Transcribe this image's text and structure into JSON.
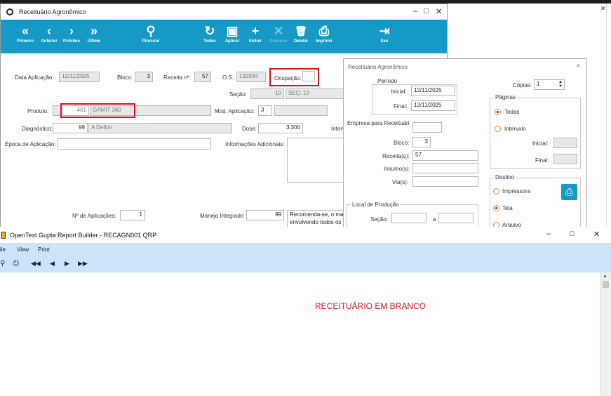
{
  "main_window": {
    "title": "Receituário Agronômico",
    "toolbar": [
      {
        "icon": "«",
        "label": "Primeiro",
        "name": "first"
      },
      {
        "icon": "‹",
        "label": "Anterior",
        "name": "previous"
      },
      {
        "icon": "›",
        "label": "Próximo",
        "name": "next"
      },
      {
        "icon": "»",
        "label": "Último",
        "name": "last"
      },
      {
        "icon": "⚲",
        "label": "Procurar",
        "name": "search"
      },
      {
        "icon": "↻",
        "label": "Todos",
        "name": "all"
      },
      {
        "icon": "▣",
        "label": "Aplicar",
        "name": "apply"
      },
      {
        "icon": "+",
        "label": "Incluir",
        "name": "include"
      },
      {
        "icon": "✕",
        "label": "Cancelar",
        "name": "cancel"
      },
      {
        "icon": "🗑",
        "label": "Deletar",
        "name": "delete"
      },
      {
        "icon": "⎙",
        "label": "Imprimir",
        "name": "print"
      },
      {
        "icon": "⇥",
        "label": "Sair",
        "name": "exit"
      }
    ],
    "form": {
      "data_aplicacao_label": "Data Aplicação:",
      "data_aplicacao": "12/11/2025",
      "bloco_label": "Bloco:",
      "bloco": "3",
      "receita_label": "Receita nº:",
      "receita": "57",
      "os_label": "O.S.:",
      "os": "132934",
      "ocupacao_label": "Ocupação:",
      "ocupacao": "",
      "secao_label": "Seção:",
      "secao": "10",
      "sec_label": "SEÇ:",
      "sec": "10",
      "produto_label": "Produto:",
      "produto_code": "461",
      "produto_name": "GAMIT 360",
      "mod_aplicacao_label": "Mod. Aplicação:",
      "mod_aplicacao": "3",
      "diagnostico_label": "Diagnóstico:",
      "diagnostico_code": "99",
      "diagnostico_name": "A Definir",
      "dose_label": "Dose:",
      "dose": "3,300",
      "interv_label": "Interv",
      "epoca_label": "Época de Aplicação:",
      "epoca": "",
      "info_label": "Informações Adicionais:",
      "n_aplicacoes_label": "Nº de Aplicações:",
      "n_aplicacoes": "1",
      "manejo_label": "Manejo Integrado",
      "manejo": "99",
      "manejo_text_1": "Recomenda-se, o ma",
      "manejo_text_2": "envolvendo todos os"
    }
  },
  "dialog": {
    "title": "Receituário Agronômico",
    "periodo_label": "Período",
    "inicial_label": "Inicial:",
    "inicial": "12/11/2025",
    "final_label": "Final:",
    "final": "12/11/2025",
    "empresa_label": "Empresa para Receituári",
    "bloco_label": "Bloco:",
    "bloco": "3",
    "receitas_label": "Receita(s):",
    "receitas": "57",
    "insumos_label": "Insumo(s):",
    "insumos": "",
    "vias_label": "Via(s):",
    "vias": "",
    "local_label": "Local de Produção",
    "secao_label": "Seção:",
    "a_label": "a",
    "copias_label": "Cópias:",
    "copias": "1",
    "paginas_label": "Páginas",
    "todas_label": "Todas",
    "intervalo_label": "Intervalo",
    "pag_inicial_label": "Inicial:",
    "pag_final_label": "Final:",
    "destino_label": "Destino",
    "impressora_label": "Impressora",
    "tela_label": "Tela",
    "arquivo_label": "Arquivo"
  },
  "report_builder": {
    "title": "OpenText Gupta Report Builder - RECAGN001.QRP",
    "menu": [
      "ile",
      "View",
      "Print"
    ],
    "content_text": "RECEITUÁRIO EM BRANCO"
  },
  "colors": {
    "toolbar": "#1699c4",
    "highlight": "#e0101a",
    "report_text": "#e0101a",
    "menubar": "#cce4f7"
  }
}
